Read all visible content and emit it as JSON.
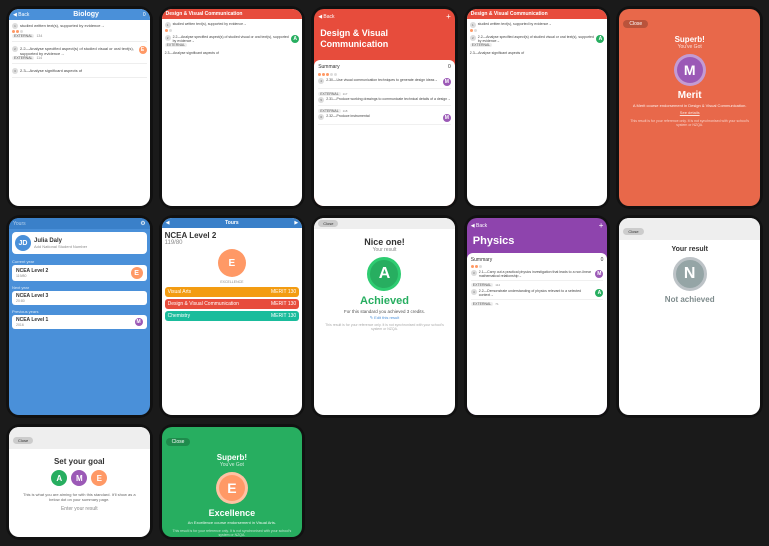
{
  "phones": [
    {
      "id": "p1",
      "type": "biology",
      "header": {
        "back": "Back",
        "title": "Biology",
        "score": "0"
      },
      "rows": [
        {
          "num": "1",
          "text": "studied written text(s), supported by evidence→",
          "tag": "EXTERNAL",
          "credits": "134"
        },
        {
          "num": "2.2",
          "text": "2.2—Analyse specified aspect(s) of studied visual or oral text(s), supported by evidence→",
          "tag": "EXTERNAL",
          "credits": "114",
          "badge": "E"
        },
        {
          "num": "2.3",
          "text": "2.3—Analyse significant aspects of",
          "tag": ""
        }
      ]
    },
    {
      "id": "p2",
      "type": "design-partial",
      "header_color": "#c0392b",
      "rows": [
        {
          "text": "studied written text(s), supported by evidence→"
        },
        {
          "text": "2.2—Analyse specified aspect(s) of studied visual or oral text(s), supported by evidence→",
          "badge": "A"
        },
        {
          "text": "2.3—Analyse significant aspects of"
        }
      ]
    },
    {
      "id": "p3",
      "type": "design-visual-main",
      "back": "Back",
      "title": "Design & Visual Communication",
      "summary_label": "Summary",
      "summary_count": "0",
      "standards": [
        {
          "num": "2.30",
          "text": "2.30—Use visual communication techniques to generate design ideas→",
          "tag": "EXTERNAL",
          "credits": "117",
          "badge": "M"
        },
        {
          "num": "2.31",
          "text": "2.31—Produce working drawings to communicate technical details of a design→",
          "tag": "EXTERNAL",
          "credits": "118",
          "badge": ""
        },
        {
          "num": "2.32",
          "text": "2.32—Produce instrumental",
          "badge": "M"
        }
      ]
    },
    {
      "id": "p4",
      "type": "design-top-right",
      "header_color": "#c0392b",
      "rows": [
        {
          "text": "studied written text(s), supported by evidence→"
        },
        {
          "text": "2.2—Analyse specified aspect(s) of studied visual or oral text(s), supported by evidence→",
          "badge": "A"
        },
        {
          "text": "2.3—Analyse significant aspects of"
        }
      ]
    },
    {
      "id": "p5",
      "type": "merit-endorsement",
      "bg_color": "#e8684a",
      "close_label": "Close",
      "superb": "Superb!",
      "you_got": "You've Got",
      "badge_letter": "M",
      "endorsement_name": "Merit",
      "description": "A Merit course endorsement in Design & Visual Communication.",
      "see_detail": "See details",
      "footer": "This result is for your reference only. It is not synchronised with your school's system or NZQA."
    },
    {
      "id": "p6",
      "type": "profile",
      "header": {
        "label": "Yours"
      },
      "name": "Julia Daly",
      "nsn": "Add National Student Number",
      "current_year": "2017",
      "current_year_label": "Current year",
      "qual": "NCEA Level 2",
      "qual_sub": "119/80",
      "qual_badge": "E",
      "next_year_label": "Next year",
      "next_qual": "Aiming towards",
      "next_level": "NCEA Level 3",
      "next_credits": "20:80",
      "prev_year_label": "Previous years",
      "prev_year": "2016",
      "prev_qual": "NCEA Level 1",
      "prev_badge": "M"
    },
    {
      "id": "p7",
      "type": "ncea-level2",
      "header_title": "Tours",
      "level_title": "NCEA Level 2",
      "credits": "119/80",
      "badge_letter": "E",
      "subjects": [
        {
          "name": "Visual Arts",
          "credits": "MERIT 130",
          "color": "yellow"
        },
        {
          "name": "Design & Visual Communication",
          "credits": "MERIT 130",
          "color": "pink"
        },
        {
          "name": "Chemistry",
          "credits": "MERIT 130",
          "color": "teal"
        }
      ]
    },
    {
      "id": "p8",
      "type": "nice-one-achieved",
      "close_label": "Close",
      "nice_label": "Nice one!",
      "result_label": "Your result",
      "badge_letter": "A",
      "achieved_label": "Achieved",
      "credits_text": "For this standard you achieved 3 credits.",
      "edit_text": "✎ Edit this result",
      "note": "This result is for your reference only. It is not synchronised with your school's system or NZQA."
    },
    {
      "id": "p9",
      "type": "physics",
      "back": "Back",
      "title": "Physics",
      "summary_label": "Summary",
      "summary_count": "0",
      "standards": [
        {
          "num": "2.1",
          "text": "2.1—Carry out a practical physics investigation that leads to a non-linear mathematical relationship→",
          "tag": "EXTERNAL",
          "credits": "114",
          "badge": "M"
        },
        {
          "num": "2.2",
          "text": "2.2—Demonstrate understanding of physics relevant to a selected context→",
          "tag": "EXTERNAL",
          "credits": "71",
          "badge": "A"
        }
      ]
    },
    {
      "id": "p10",
      "type": "not-achieved",
      "close_label": "Close",
      "result_title": "Your result",
      "badge_letter": "N",
      "not_achieved_label": "Not achieved"
    },
    {
      "id": "p11",
      "type": "set-goal",
      "close_label": "Close",
      "title": "Set your goal",
      "goals": [
        "A",
        "M",
        "E"
      ],
      "desc": "This is what you are aiming for with this standard. It'll show as a below dot on your summary page.",
      "enter_label": "Enter your result"
    },
    {
      "id": "p12",
      "type": "excellence-endorsement",
      "bg_color": "#27ae60",
      "close_label": "Close",
      "superb": "Superb!",
      "you_got": "You've Got",
      "badge_letter": "E",
      "endorsement_name": "Excellence",
      "description": "An Excellence course endorsement in Visual Arts.",
      "footer": "This result is for your reference only. It is not synchronised with your school's system or NZQA."
    }
  ]
}
